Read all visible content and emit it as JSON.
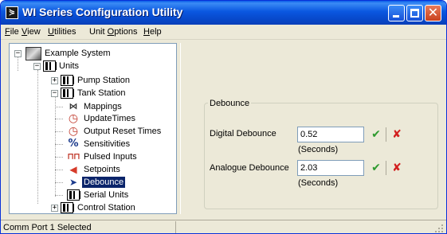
{
  "window": {
    "title": "WI Series Configuration Utility",
    "app_icon_glyph": "⋟",
    "buttons": [
      "minimize",
      "maximize",
      "close"
    ]
  },
  "menu": [
    {
      "label": "File",
      "ul": "F",
      "rest": "ile"
    },
    {
      "label": "View",
      "ul": "V",
      "rest": "iew"
    },
    {
      "label": "Utilities",
      "ul": "U",
      "rest": "tilities"
    },
    {
      "label": "Unit Options",
      "pre": "Unit ",
      "ul": "O",
      "rest": "ptions"
    },
    {
      "label": "Help",
      "ul": "H",
      "rest": "elp"
    }
  ],
  "tree": {
    "root": "Example System",
    "units": "Units",
    "pump_station": "Pump Station",
    "tank_station": "Tank Station",
    "children": [
      {
        "label": "Mappings",
        "icon": "mappings-icon",
        "color": "#333333"
      },
      {
        "label": "UpdateTimes",
        "icon": "clock-icon",
        "color": "#c0392b"
      },
      {
        "label": "Output Reset Times",
        "icon": "clock-icon",
        "color": "#c0392b"
      },
      {
        "label": "Sensitivities",
        "icon": "percent-icon",
        "color": "#1b3a8c"
      },
      {
        "label": "Pulsed Inputs",
        "icon": "pulse-icon",
        "color": "#c0392b"
      },
      {
        "label": "Setpoints",
        "icon": "setpoint-icon",
        "color": "#d63b2a"
      },
      {
        "label": "Debounce",
        "icon": "debounce-icon",
        "color": "#1b3a8c"
      },
      {
        "label": "Serial Units",
        "icon": "unit-icon",
        "color": "#000000"
      }
    ],
    "control_station": "Control Station",
    "selected": "Debounce"
  },
  "debounce": {
    "group_title": "Debounce",
    "digital_label": "Digital Debounce",
    "digital_value": "0.52",
    "digital_units": "(Seconds)",
    "analogue_label": "Analogue Debounce",
    "analogue_value": "2.03",
    "analogue_units": "(Seconds)"
  },
  "colors": {
    "accept": "#2e9a2e",
    "reject": "#d21f1f",
    "selection": "#0a246a"
  },
  "status": {
    "text": "Comm Port 1 Selected"
  }
}
